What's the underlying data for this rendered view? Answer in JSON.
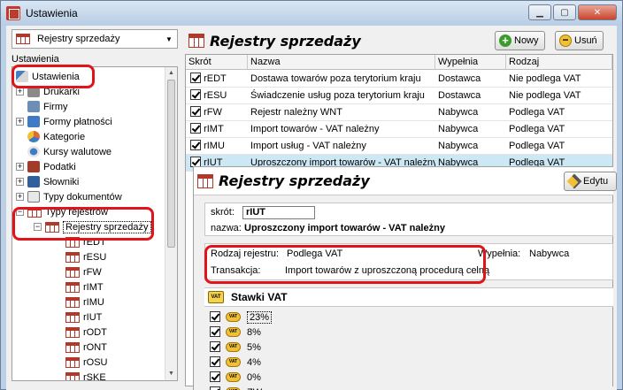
{
  "window": {
    "title": "Ustawienia",
    "controls": {
      "minimize": "▁",
      "maximize": "▢",
      "close": "✕"
    }
  },
  "left": {
    "combo": {
      "selected": "Rejestry sprzedaży",
      "arrow": "▼"
    },
    "label": "Ustawienia",
    "tree": [
      {
        "label": "Ustawienia"
      },
      {
        "label": "Drukarki",
        "expander": "+"
      },
      {
        "label": "Firmy"
      },
      {
        "label": "Formy płatności",
        "expander": "+"
      },
      {
        "label": "Kategorie"
      },
      {
        "label": "Kursy walutowe"
      },
      {
        "label": "Podatki",
        "expander": "+"
      },
      {
        "label": "Słowniki",
        "expander": "+"
      },
      {
        "label": "Typy dokumentów",
        "expander": "+"
      },
      {
        "label": "Typy rejestrów",
        "expander": "−"
      },
      {
        "label": "Rejestry sprzedaży",
        "expander": "−"
      },
      {
        "label": "rEDT"
      },
      {
        "label": "rESU"
      },
      {
        "label": "rFW"
      },
      {
        "label": "rIMT"
      },
      {
        "label": "rIMU"
      },
      {
        "label": "rIUT"
      },
      {
        "label": "rODT"
      },
      {
        "label": "rONT"
      },
      {
        "label": "rOSU"
      },
      {
        "label": "rSKE"
      }
    ],
    "scroll": {
      "up": "▲",
      "down": "▼"
    }
  },
  "right": {
    "title": "Rejestry sprzedaży",
    "new_label": "Nowy",
    "delete_label": "Usuń",
    "plus_glyph": "+",
    "minus_glyph": "−",
    "columns": [
      "Skrót",
      "Nazwa",
      "Wypełnia",
      "Rodzaj"
    ],
    "rows": [
      {
        "code": "rEDT",
        "name": "Dostawa towarów poza terytorium kraju",
        "fills": "Dostawca",
        "kind": "Nie podlega VAT"
      },
      {
        "code": "rESU",
        "name": "Świadczenie usług poza terytorium kraju",
        "fills": "Dostawca",
        "kind": "Nie podlega VAT"
      },
      {
        "code": "rFW",
        "name": "Rejestr należny WNT",
        "fills": "Nabywca",
        "kind": "Podlega VAT"
      },
      {
        "code": "rIMT",
        "name": "Import towarów - VAT należny",
        "fills": "Nabywca",
        "kind": "Podlega VAT"
      },
      {
        "code": "rIMU",
        "name": "Import usług - VAT należny",
        "fills": "Nabywca",
        "kind": "Podlega VAT"
      },
      {
        "code": "rIUT",
        "name": "Uproszczony import towarów - VAT należny",
        "fills": "Nabywca",
        "kind": "Podlega VAT"
      }
    ]
  },
  "detail": {
    "title": "Rejestry sprzedaży",
    "edit_label": "Edytu",
    "code_label": "skrót:",
    "code_value": "rIUT",
    "name_label": "nazwa:",
    "name_value": "Uproszczony import towarów - VAT należny",
    "kind_label": "Rodzaj rejestru:",
    "kind_value": "Podlega VAT",
    "fills_label": "Wypełnia:",
    "fills_value": "Nabywca",
    "transaction_label": "Transakcja:",
    "transaction_value": "Import towarów z uproszczoną procedurą celną",
    "vat_header": "Stawki VAT",
    "vat_badge": "VAT",
    "vat_rates": [
      "23%",
      "8%",
      "5%",
      "4%",
      "0%",
      "ZW"
    ]
  },
  "colors": {
    "highlight_ring": "#e0141a",
    "selected_row": "#cce8f5",
    "accent_red": "#b0392b"
  }
}
